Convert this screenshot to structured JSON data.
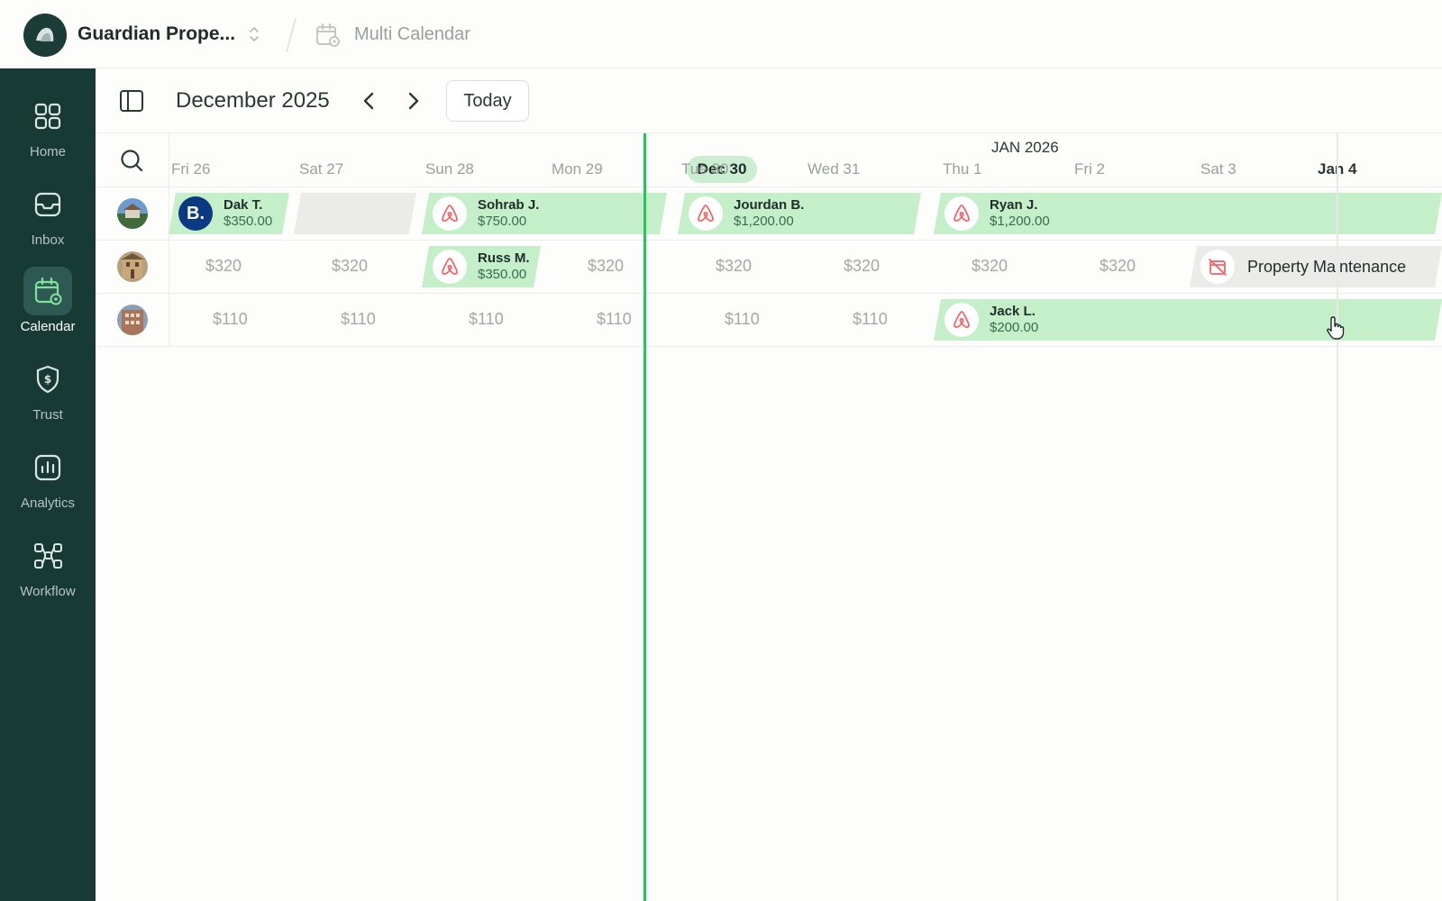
{
  "topbar": {
    "org_name": "Guardian Prope...",
    "breadcrumb": "Multi Calendar"
  },
  "sidebar": {
    "items": [
      {
        "label": "Home",
        "icon": "grid-icon"
      },
      {
        "label": "Inbox",
        "icon": "inbox-icon"
      },
      {
        "label": "Calendar",
        "icon": "calendar-icon",
        "active": true
      },
      {
        "label": "Trust",
        "icon": "shield-dollar-icon"
      },
      {
        "label": "Analytics",
        "icon": "chart-icon"
      },
      {
        "label": "Workflow",
        "icon": "workflow-icon"
      }
    ]
  },
  "toolbar": {
    "month": "December 2025",
    "today_label": "Today"
  },
  "calendar": {
    "month_marker": "JAN 2026",
    "today_pill": "Dec 30",
    "days": [
      "Fri 26",
      "Sat 27",
      "Sun 28",
      "Mon 29",
      "Tue 30",
      "Wed 31",
      "Thu 1",
      "Fri 2",
      "Sat 3",
      "Jan 4"
    ],
    "rows": [
      {
        "bookings": [
          {
            "source": "booking-com",
            "source_letter": "B.",
            "guest": "Dak T.",
            "amount": "$350.00"
          },
          {
            "source": "airbnb",
            "guest": "Sohrab J.",
            "amount": "$750.00"
          },
          {
            "source": "airbnb",
            "guest": "Jourdan B.",
            "amount": "$1,200.00"
          },
          {
            "source": "airbnb",
            "guest": "Ryan J.",
            "amount": "$1,200.00"
          }
        ]
      },
      {
        "prices": [
          "$320",
          "$320",
          "$320",
          "$320",
          "$320",
          "$320",
          "$320"
        ],
        "bookings": [
          {
            "source": "airbnb",
            "guest": "Russ M.",
            "amount": "$350.00"
          }
        ],
        "block": {
          "label": "Property Maintenance",
          "icon": "calendar-blocked-icon"
        }
      },
      {
        "prices": [
          "$110",
          "$110",
          "$110",
          "$110",
          "$110",
          "$110"
        ],
        "bookings": [
          {
            "source": "airbnb",
            "guest": "Jack L.",
            "amount": "$200.00"
          }
        ]
      }
    ]
  },
  "colors": {
    "sidebar_bg": "#173a35",
    "booking_fill": "#c5efc8",
    "today_line": "#22c55e",
    "airbnb": "#ff5a5f",
    "booking_com": "#0b3a82"
  }
}
